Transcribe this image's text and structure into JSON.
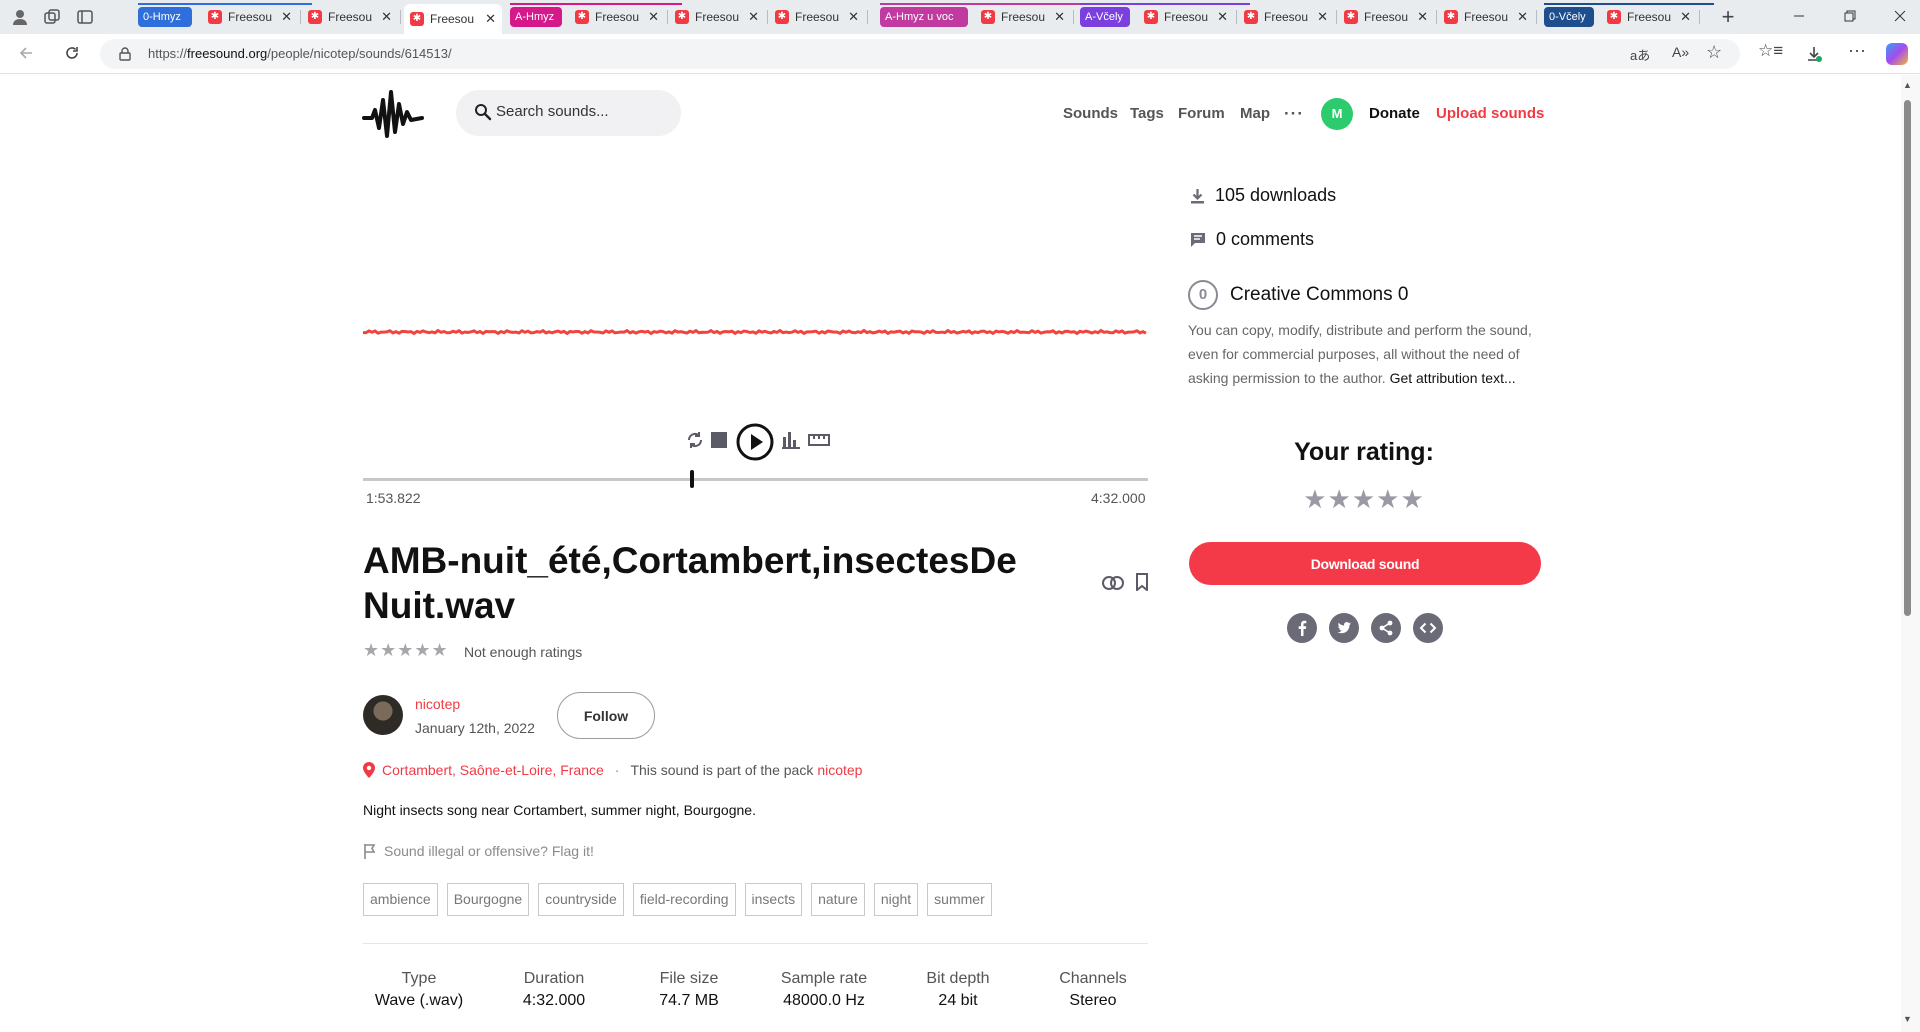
{
  "browser": {
    "tabs": [
      {
        "kind": "group",
        "label": "0-Hmyz",
        "color": "#2f6fdb"
      },
      {
        "kind": "tab",
        "label": "Freesou"
      },
      {
        "kind": "tab",
        "label": "Freesou"
      },
      {
        "kind": "tab",
        "label": "Freesou",
        "active": true
      },
      {
        "kind": "group",
        "label": "A-Hmyz",
        "color": "#d6198a"
      },
      {
        "kind": "tab",
        "label": "Freesou"
      },
      {
        "kind": "tab",
        "label": "Freesou"
      },
      {
        "kind": "tab",
        "label": "Freesou"
      },
      {
        "kind": "group",
        "label": "A-Hmyz u voc",
        "color": "#c13aa0"
      },
      {
        "kind": "tab",
        "label": "Freesou"
      },
      {
        "kind": "group",
        "label": "A-Včely",
        "color": "#7b3fe0"
      },
      {
        "kind": "tab",
        "label": "Freesou"
      },
      {
        "kind": "tab",
        "label": "Freesou"
      },
      {
        "kind": "tab",
        "label": "Freesou"
      },
      {
        "kind": "tab",
        "label": "Freesou"
      },
      {
        "kind": "group",
        "label": "0-Včely",
        "color": "#1f4e8f"
      },
      {
        "kind": "tab",
        "label": "Freesou"
      }
    ],
    "url_prefix": "https://",
    "url_domain": "freesound.org",
    "url_path": "/people/nicotep/sounds/614513/",
    "new_tab": "+"
  },
  "header": {
    "search_placeholder": "Search sounds...",
    "nav": [
      "Sounds",
      "Tags",
      "Forum",
      "Map"
    ],
    "more": "···",
    "avatar_letter": "M",
    "donate": "Donate",
    "upload": "Upload sounds"
  },
  "player": {
    "current_time": "1:53.822",
    "total_time": "4:32.000",
    "progress": 0.419,
    "wave_color": "#f0453c"
  },
  "sound": {
    "title": "AMB-nuit_été,Cortambert,insectesDeNuit.wav",
    "rating_stars": "★★★★★",
    "rating_text": "Not enough ratings",
    "user": "nicotep",
    "date": "January 12th, 2022",
    "follow": "Follow",
    "location": "Cortambert, Saône-et-Loire, France",
    "separator": "·",
    "pack_prefix": "This sound is part of the pack",
    "pack": "nicotep",
    "description": "Night insects song near Cortambert, summer night, Bourgogne.",
    "flag_text": "Sound illegal or offensive? Flag it!",
    "tags": [
      "ambience",
      "Bourgogne",
      "countryside",
      "field-recording",
      "insects",
      "nature",
      "night",
      "summer"
    ],
    "specs": [
      {
        "k": "Type",
        "v": "Wave (.wav)"
      },
      {
        "k": "Duration",
        "v": "4:32.000"
      },
      {
        "k": "File size",
        "v": "74.7 MB"
      },
      {
        "k": "Sample rate",
        "v": "48000.0 Hz"
      },
      {
        "k": "Bit depth",
        "v": "24 bit"
      },
      {
        "k": "Channels",
        "v": "Stereo"
      }
    ]
  },
  "sidebar": {
    "downloads": "105 downloads",
    "comments": "0 comments",
    "cc_badge": "0",
    "license_title": "Creative Commons 0",
    "license_text": "You can copy, modify, distribute and perform the sound, even for commercial purposes, all without the need of asking permission to the author.",
    "attribution_link": "Get attribution text...",
    "your_rating": "Your rating:",
    "your_rating_stars": "★★★★★",
    "download_button": "Download sound",
    "share_icons": [
      "facebook-icon",
      "twitter-icon",
      "share-icon",
      "embed-icon"
    ]
  },
  "colors": {
    "accent": "#f23a45",
    "muted": "#6b6b78"
  }
}
